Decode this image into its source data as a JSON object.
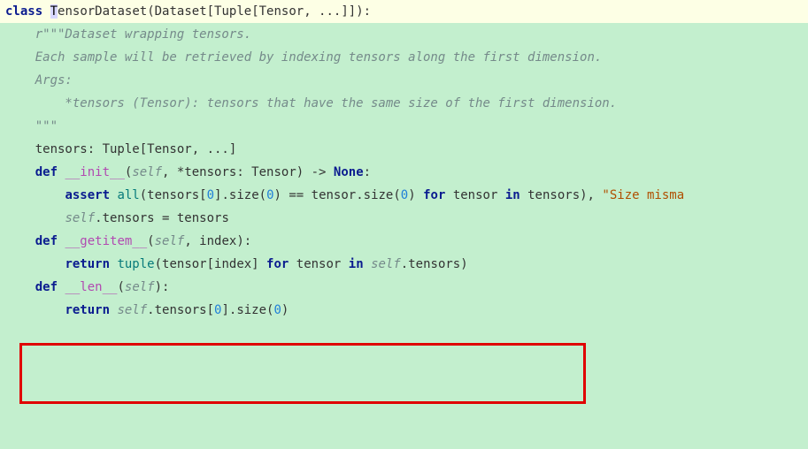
{
  "code": {
    "l1_class": "class",
    "l1_name_start_chr": "T",
    "l1_name_rest": "ensorDataset",
    "l1_base": "(Dataset[Tuple[Tensor, ...]]):",
    "l2": "    r\"\"\"Dataset wrapping tensors.",
    "l3": "",
    "l4": "    Each sample will be retrieved by indexing tensors along the first dimension.",
    "l5": "",
    "l6": "    Args:",
    "l7": "        *tensors (Tensor): tensors that have the same size of the first dimension.",
    "l8": "    \"\"\"",
    "l9": "    tensors: Tuple[Tensor, ...]",
    "l10": "",
    "l11_def": "    def",
    "l11_fn": " __init__",
    "l11_args_a": "(",
    "l11_self": "self",
    "l11_args_b": ", *tensors: Tensor) -> ",
    "l11_none": "None",
    "l11_colon": ":",
    "l12_ind": "        ",
    "l12_assert": "assert",
    "l12_sp1": " ",
    "l12_all": "all",
    "l12_a": "(tensors[",
    "l12_zero1": "0",
    "l12_b": "].size(",
    "l12_zero2": "0",
    "l12_c": ") == tensor.size(",
    "l12_zero3": "0",
    "l12_d": ") ",
    "l12_for": "for",
    "l12_e": " tensor ",
    "l12_in": "in",
    "l12_f": " tensors), ",
    "l12_str": "\"Size misma",
    "l13_ind": "        ",
    "l13_self": "self",
    "l13_rest": ".tensors = tensors",
    "l14": "",
    "l15_def": "    def",
    "l15_fn": " __getitem__",
    "l15_args_a": "(",
    "l15_self": "self",
    "l15_args_b": ", index):",
    "l16_ind": "        ",
    "l16_return": "return",
    "l16_sp": " ",
    "l16_tuple": "tuple",
    "l16_a": "(tensor[index] ",
    "l16_for": "for",
    "l16_b": " tensor ",
    "l16_in": "in",
    "l16_sp2": " ",
    "l16_self": "self",
    "l16_c": ".tensors)",
    "l17": "",
    "l18_def": "    def",
    "l18_fn": " __len__",
    "l18_args_a": "(",
    "l18_self": "self",
    "l18_args_b": "):",
    "l19_ind": "        ",
    "l19_return": "return",
    "l19_sp": " ",
    "l19_self": "self",
    "l19_a": ".tensors[",
    "l19_zero": "0",
    "l19_b": "].size(",
    "l19_zero2": "0",
    "l19_c": ")"
  }
}
